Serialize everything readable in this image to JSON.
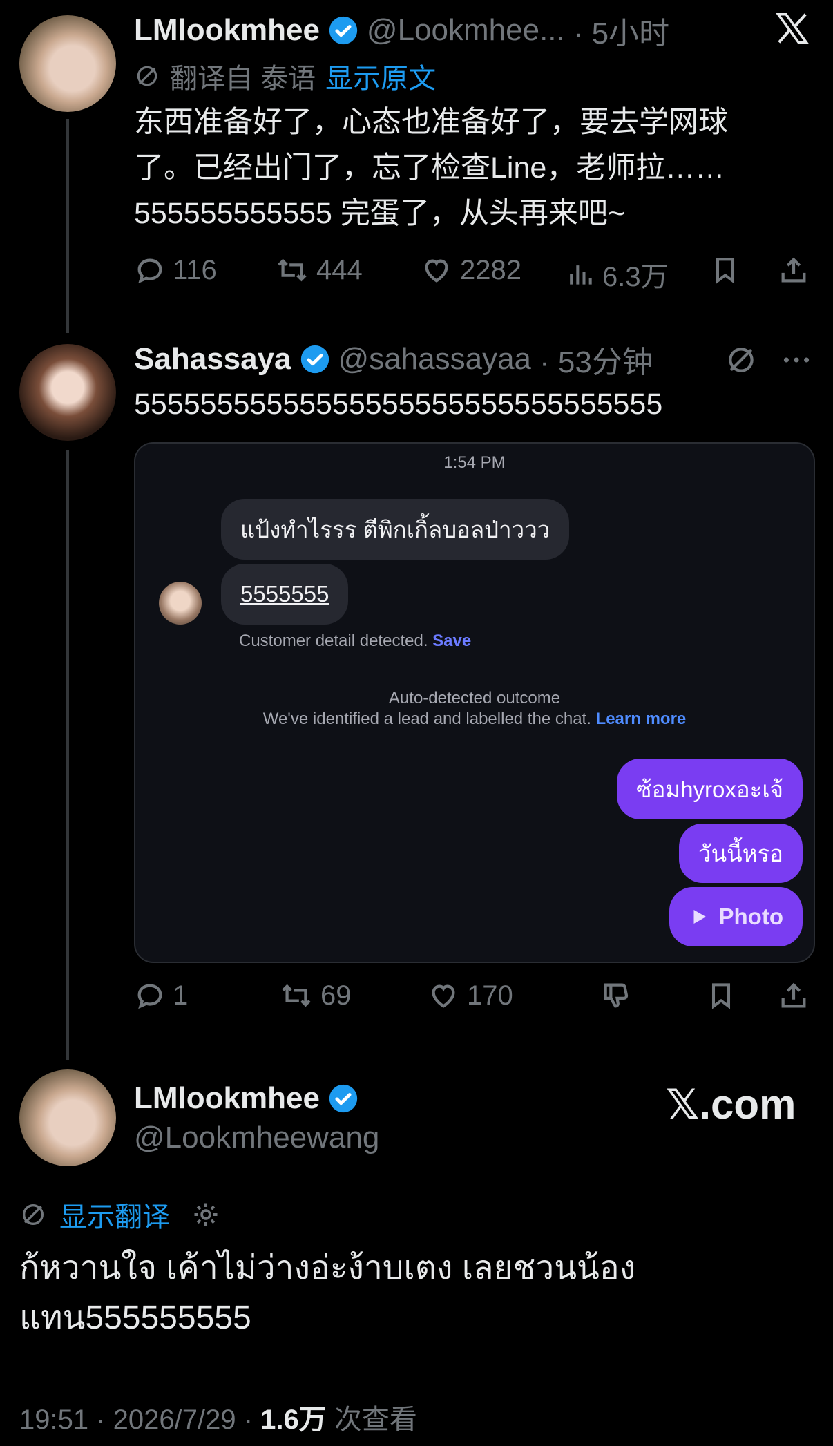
{
  "tweet1": {
    "name": "LMlookmhee",
    "handle": "@Lookmhee...",
    "time": "· 5小时",
    "translate_note": "翻译自 泰语",
    "show_original": "显示原文",
    "text_line1": "东西准备好了，心态也准备好了，要去学网球",
    "text_line2": "了。已经出门了，忘了检查Line，老师拉……",
    "text_line3": "555555555555 完蛋了，从头再来吧~",
    "replies": "116",
    "retweets": "444",
    "likes": "2282",
    "views": "6.3万"
  },
  "tweet2": {
    "name": "Sahassaya",
    "handle": "@sahassayaa",
    "time": "· 53分钟",
    "text": "55555555555555555555555555555555",
    "replies": "1",
    "retweets": "69",
    "likes": "170"
  },
  "chat": {
    "time": "1:54 PM",
    "msg1": "แป้งทำไรรร ตีพิกเกิ้ลบอลป่าววว",
    "msg2": "5555555",
    "detected": "Customer detail detected.",
    "save": "Save",
    "outcome_title": "Auto-detected outcome",
    "outcome_text": "We've identified a lead and labelled the chat.",
    "learn_more": "Learn more",
    "out1": "ซ้อมhyroxอะเจ้",
    "out2": "วันนี้หรอ",
    "out3": "Photo"
  },
  "tweet3": {
    "name": "LMlookmhee",
    "handle": "@Lookmheewang",
    "brand": "𝕏.com",
    "show_translation": "显示翻译",
    "text_line1": "ก้หวานใจ เค้าไม่ว่างอ่ะง้าบเตง เลยชวนน้อง",
    "text_line2": "แทน555555555",
    "timestamp": "19:51 · 2026/7/29 · ",
    "views_count": "1.6万",
    "views_label": " 次查看"
  },
  "colors": {
    "accent": "#1d9bf0",
    "bubble_out": "#7a3df2",
    "muted": "#71767b"
  }
}
